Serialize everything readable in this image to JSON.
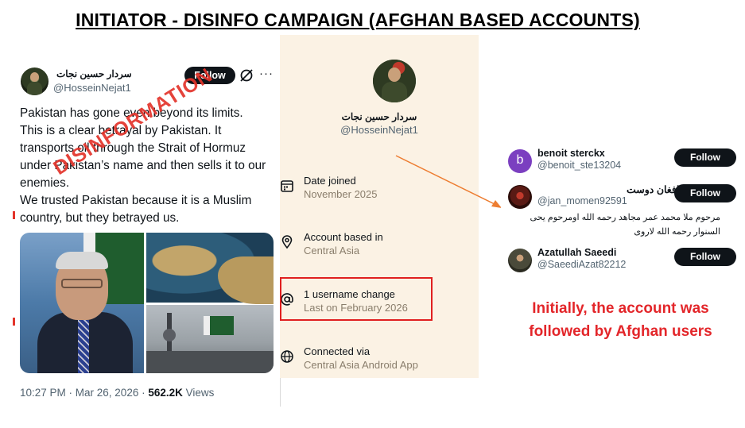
{
  "title": "INITIATOR - DISINFO CAMPAIGN (AFGHAN BASED ACCOUNTS)",
  "tweet": {
    "display_name": "سردار حسين نجات",
    "handle": "@HosseinNejat1",
    "follow_label": "Follow",
    "more_label": "···",
    "text_lines": [
      "Pakistan has gone even beyond its limits.",
      "This is a clear betrayal by Pakistan. It",
      "transports oil through the Strait of Hormuz",
      "under Pakistan’s name and then sells it to our",
      "enemies.",
      "We trusted Pakistan because it is a Muslim",
      "country, but they betrayed us."
    ],
    "time": "10:27 PM · Mar 26, 2026 · ",
    "views_count": "562.2K",
    "views_label": " Views",
    "stamp": "DISINFORMATION"
  },
  "profile": {
    "display_name": "سردار حسين نجات",
    "handle": "@HosseinNejat1",
    "rows": [
      {
        "icon": "calendar-icon",
        "label": "Date joined",
        "value": "November 2025"
      },
      {
        "icon": "location-pin-icon",
        "label": "Account based in",
        "value": "Central Asia"
      },
      {
        "icon": "at-sign-icon",
        "label": "1 username change",
        "value": "Last on February 2026"
      },
      {
        "icon": "globe-icon",
        "label": "Connected via",
        "value": "Central Asia Android App"
      }
    ]
  },
  "followers": [
    {
      "avatar_letter": "b",
      "name": "benoit sterckx",
      "handle": "@benoit_ste13204",
      "bio_lines": [],
      "button": "Follow"
    },
    {
      "avatar_letter": "",
      "name": "افغان دوست",
      "handle": "@jan_momen92591",
      "bio_lines": [
        "مرحوم ملا محمد عمر مجاهد رحمه الله اومرحوم يحى",
        "السنوار رحمه الله لاروى"
      ],
      "button": "Follow"
    },
    {
      "avatar_letter": "",
      "name": "Azatullah Saeedi",
      "handle": "@SaeediAzat82212",
      "bio_lines": [],
      "button": "Follow"
    }
  ],
  "caption_lines": [
    "Initially, the account was",
    "followed by Afghan users"
  ],
  "colors": {
    "accent_red": "#e3262a",
    "panel_bg": "#fbf2e4",
    "button_bg": "#0f1419",
    "muted_text": "#536471"
  }
}
